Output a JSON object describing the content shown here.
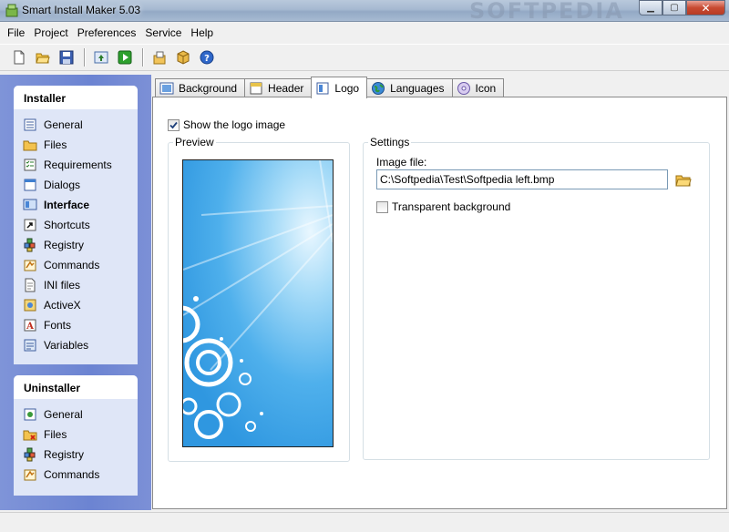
{
  "window": {
    "title": "Smart Install Maker 5.03",
    "watermark": "SOFTPEDIA"
  },
  "menu": [
    "File",
    "Project",
    "Preferences",
    "Service",
    "Help"
  ],
  "toolbar_icons": [
    "new-document-icon",
    "open-folder-icon",
    "save-icon",
    "export-icon",
    "build-run-icon",
    "open-project-icon",
    "box-icon",
    "help-icon"
  ],
  "installer": {
    "heading": "Installer",
    "items": [
      {
        "label": "General",
        "icon": "general-icon"
      },
      {
        "label": "Files",
        "icon": "folder-icon"
      },
      {
        "label": "Requirements",
        "icon": "requirements-icon"
      },
      {
        "label": "Dialogs",
        "icon": "dialogs-icon"
      },
      {
        "label": "Interface",
        "icon": "interface-icon"
      },
      {
        "label": "Shortcuts",
        "icon": "shortcut-icon"
      },
      {
        "label": "Registry",
        "icon": "registry-icon"
      },
      {
        "label": "Commands",
        "icon": "commands-icon"
      },
      {
        "label": "INI files",
        "icon": "ini-file-icon"
      },
      {
        "label": "ActiveX",
        "icon": "activex-icon"
      },
      {
        "label": "Fonts",
        "icon": "fonts-icon"
      },
      {
        "label": "Variables",
        "icon": "variables-icon"
      }
    ],
    "active": "Interface"
  },
  "uninstaller": {
    "heading": "Uninstaller",
    "items": [
      {
        "label": "General",
        "icon": "general-icon"
      },
      {
        "label": "Files",
        "icon": "folder-delete-icon"
      },
      {
        "label": "Registry",
        "icon": "registry-icon"
      },
      {
        "label": "Commands",
        "icon": "commands-icon"
      }
    ]
  },
  "tabs": [
    {
      "label": "Background",
      "icon": "background-icon"
    },
    {
      "label": "Header",
      "icon": "header-icon"
    },
    {
      "label": "Logo",
      "icon": "logo-icon"
    },
    {
      "label": "Languages",
      "icon": "globe-icon"
    },
    {
      "label": "Icon",
      "icon": "disc-icon"
    }
  ],
  "selected_tab": "Logo",
  "logo": {
    "show_logo_label": "Show the logo image",
    "show_logo_checked": true,
    "preview_legend": "Preview",
    "settings_legend": "Settings",
    "image_file_label": "Image file:",
    "image_file_value": "C:\\Softpedia\\Test\\Softpedia left.bmp",
    "transparent_label": "Transparent background",
    "transparent_checked": false
  },
  "colors": {
    "sidebar": "#6c84d2",
    "group_bg": "#dfe6f7",
    "accent": "#2f97e0"
  }
}
